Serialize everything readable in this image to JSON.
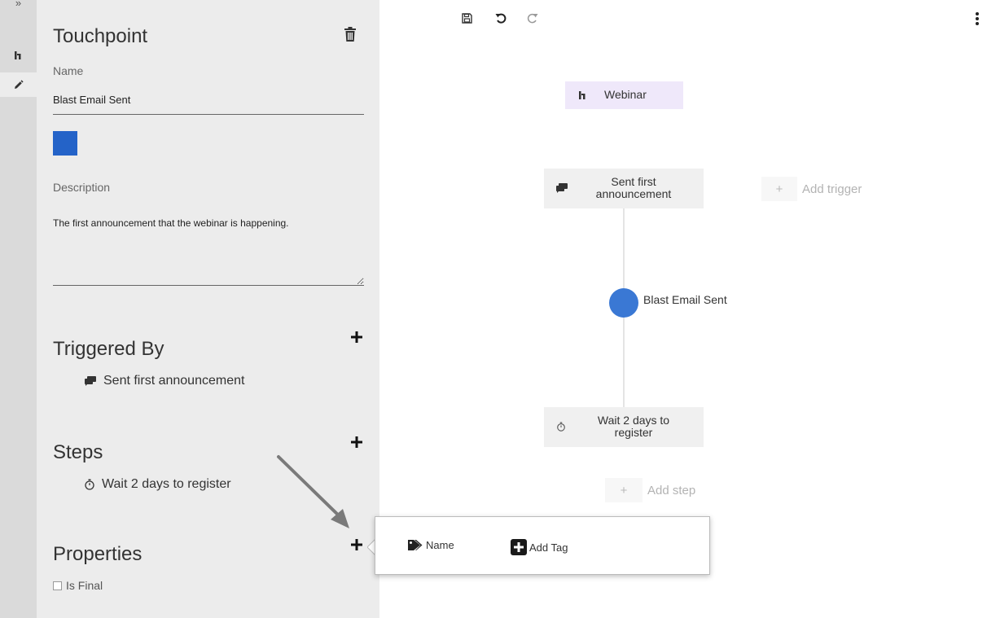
{
  "rail": {
    "expand_label": "»"
  },
  "panel": {
    "title": "Touchpoint",
    "name_label": "Name",
    "name_value": "Blast Email Sent",
    "color": "#2463c8",
    "description_label": "Description",
    "description_value": "The first announcement that the webinar is happening.",
    "triggered_by": {
      "heading": "Triggered By",
      "items": [
        "Sent first announcement"
      ]
    },
    "steps": {
      "heading": "Steps",
      "items": [
        "Wait 2 days to register"
      ]
    },
    "properties": {
      "heading": "Properties",
      "is_final_label": "Is Final"
    }
  },
  "canvas": {
    "root_node": "Webinar",
    "trigger_node": "Sent first announcement",
    "add_trigger_label": "Add trigger",
    "touchpoint_label": "Blast Email Sent",
    "step_node": "Wait 2 days to register",
    "add_step_label": "Add step",
    "plus_glyph": "+"
  },
  "popover": {
    "name_label": "Name",
    "add_tag_label": "Add Tag"
  },
  "colors": {
    "accent": "#3a78d4",
    "swatch": "#2463c8",
    "root_node_bg": "#efe8fa"
  }
}
